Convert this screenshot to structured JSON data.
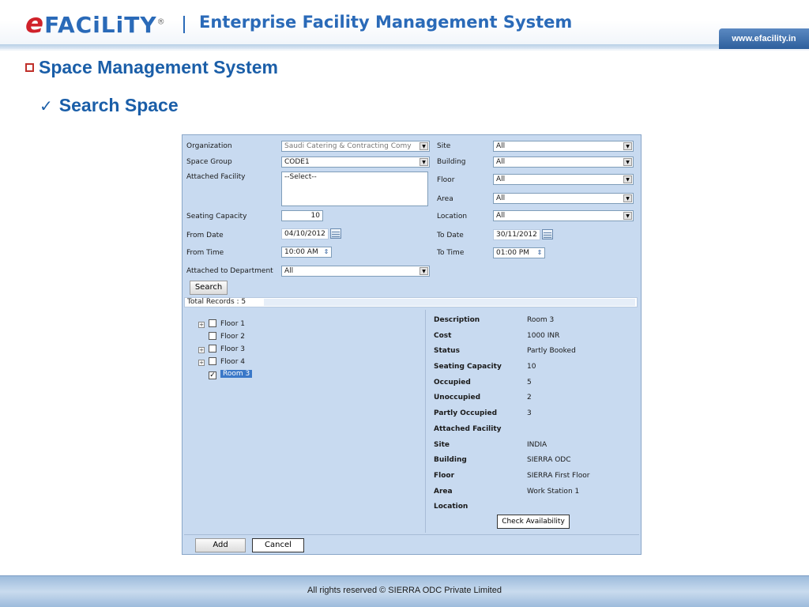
{
  "header": {
    "logo_e": "e",
    "logo_text": "FACiLiTY",
    "logo_reg": "®",
    "title": "Enterprise Facility Management System",
    "url": "www.efacility.in"
  },
  "sections": {
    "main_title": "Space Management System",
    "sub_check": "✓",
    "sub_title": "Search Space"
  },
  "form": {
    "organization_label": "Organization",
    "organization_value": "Saudi Catering & Contracting Comy",
    "space_group_label": "Space Group",
    "space_group_value": "CODE1",
    "attached_facility_label": "Attached Facility",
    "attached_facility_value": "--Select--",
    "seating_capacity_label": "Seating Capacity",
    "seating_capacity_value": "10",
    "from_date_label": "From Date",
    "from_date_value": "04/10/2012",
    "from_time_label": "From Time",
    "from_time_value": "10:00 AM",
    "attached_department_label": "Attached to Department",
    "attached_department_value": "All",
    "site_label": "Site",
    "site_value": "All",
    "building_label": "Building",
    "building_value": "All",
    "floor_label": "Floor",
    "floor_value": "All",
    "area_label": "Area",
    "area_value": "All",
    "location_label": "Location",
    "location_value": "All",
    "to_date_label": "To Date",
    "to_date_value": "30/11/2012",
    "to_time_label": "To Time",
    "to_time_value": "01:00 PM",
    "search_button": "Search"
  },
  "results": {
    "total_records": "Total Records : 5",
    "tree": [
      {
        "label": "Floor 1",
        "expandable": true,
        "checked": false
      },
      {
        "label": "Floor 2",
        "expandable": false,
        "checked": false
      },
      {
        "label": "Floor 3",
        "expandable": true,
        "checked": false
      },
      {
        "label": "Floor 4",
        "expandable": true,
        "checked": false
      },
      {
        "label": "Room 3",
        "expandable": false,
        "checked": true
      }
    ],
    "details": [
      {
        "key": "Description",
        "value": "Room 3"
      },
      {
        "key": "Cost",
        "value": "1000 INR"
      },
      {
        "key": "Status",
        "value": "Partly Booked"
      },
      {
        "key": "Seating Capacity",
        "value": "10"
      },
      {
        "key": "Occupied",
        "value": "5"
      },
      {
        "key": "Unoccupied",
        "value": "2"
      },
      {
        "key": "Partly Occupied",
        "value": "3"
      },
      {
        "key": "Attached Facility",
        "value": ""
      },
      {
        "key": "Site",
        "value": "INDIA"
      },
      {
        "key": "Building",
        "value": "SIERRA ODC"
      },
      {
        "key": "Floor",
        "value": "SIERRA First Floor"
      },
      {
        "key": "Area",
        "value": "Work Station 1"
      },
      {
        "key": "Location",
        "value": ""
      }
    ],
    "check_availability_button": "Check Availability",
    "add_button": "Add",
    "cancel_button": "Cancel"
  },
  "footer": {
    "text": "All rights reserved © SIERRA ODC Private Limited"
  },
  "colors": {
    "brand_blue": "#1a5ea8",
    "logo_red": "#d0222a",
    "panel_bg": "#c8daf0",
    "selection_blue": "#3a78c8"
  },
  "icons": {
    "dropdown": "dropdown-arrow-icon",
    "calendar": "calendar-icon",
    "spinner": "spinner-icon",
    "expand": "expand-plus-icon",
    "checkbox": "checkbox-icon"
  }
}
